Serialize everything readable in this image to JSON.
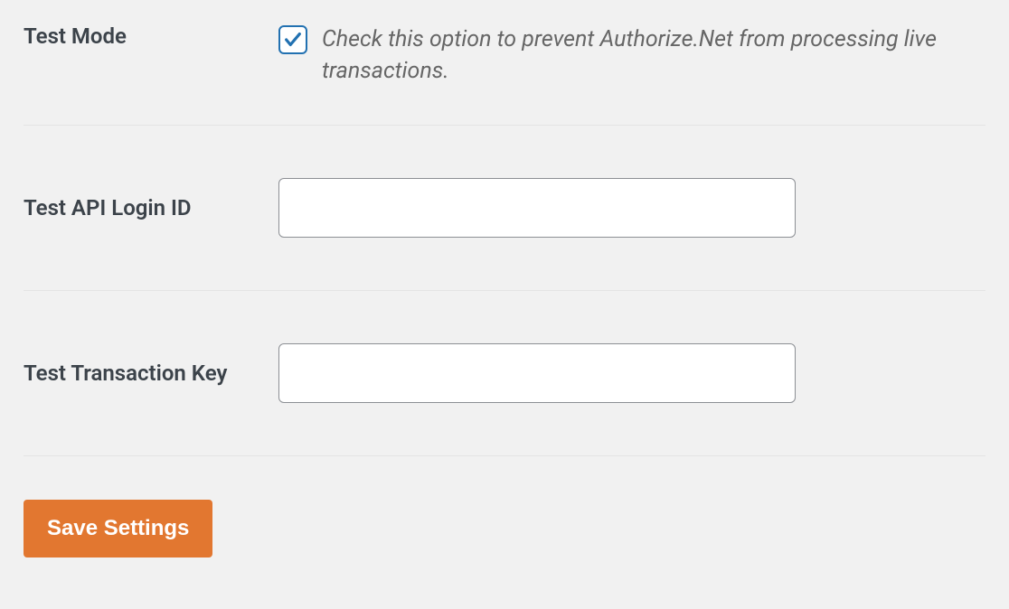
{
  "fields": {
    "test_mode": {
      "label": "Test Mode",
      "checked": true,
      "description": "Check this option to prevent Authorize.Net from processing live transactions."
    },
    "test_api_login_id": {
      "label": "Test API Login ID",
      "value": ""
    },
    "test_transaction_key": {
      "label": "Test Transaction Key",
      "value": ""
    }
  },
  "buttons": {
    "save": "Save Settings"
  }
}
